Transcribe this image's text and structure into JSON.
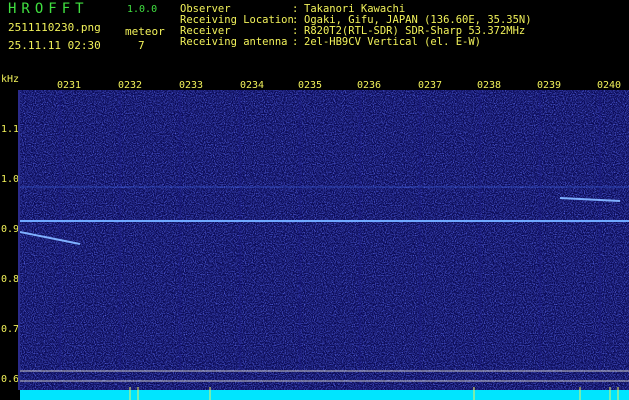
{
  "header": {
    "app_title": "HROFFT",
    "version": "1.0.0",
    "filename": "2511110230.png",
    "meteor_label": "meteor",
    "datetime": "25.11.11 02:30",
    "meteor_count": "7"
  },
  "info": [
    {
      "key": "Observer",
      "value": "Takanori Kawachi"
    },
    {
      "key": "Receiving Location",
      "value": "Ogaki, Gifu, JAPAN (136.60E, 35.35N)"
    },
    {
      "key": "Receiver",
      "value": "R820T2(RTL-SDR) SDR-Sharp 53.372MHz"
    },
    {
      "key": "Receiving antenna",
      "value": "2el-HB9CV Vertical (el. E-W)"
    }
  ],
  "axis": {
    "y_unit": "kHz",
    "y_ticks": [
      "1.1",
      "1.0",
      "0.9",
      "0.8",
      "0.7",
      "0.6"
    ],
    "x_ticks": [
      "0231",
      "0232",
      "0233",
      "0234",
      "0235",
      "0236",
      "0237",
      "0238",
      "0239",
      "0240"
    ]
  },
  "colors": {
    "background": "#000000",
    "spectrogram_bg": "#0a0a55",
    "label_yellow": "#f2f25a",
    "title_green": "#40e040",
    "signal_line": "#6fa8ff",
    "bottom_bar": "#00e5ff"
  }
}
